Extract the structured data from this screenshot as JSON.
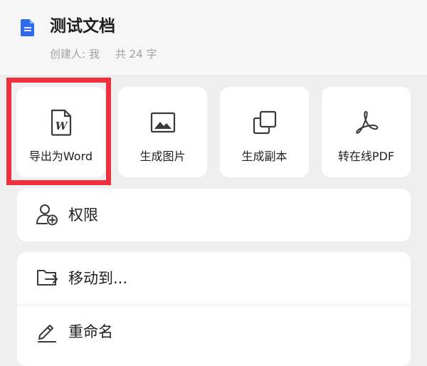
{
  "document": {
    "title": "测试文档",
    "creator": "创建人: 我",
    "word_count": "共 24 字"
  },
  "actions": [
    {
      "label": "导出为Word",
      "icon": "word-file-icon"
    },
    {
      "label": "生成图片",
      "icon": "image-icon"
    },
    {
      "label": "生成副本",
      "icon": "copy-icon"
    },
    {
      "label": "转在线PDF",
      "icon": "pdf-icon"
    }
  ],
  "menu": {
    "permissions": {
      "label": "权限",
      "icon": "user-add-icon"
    },
    "move_to": {
      "label": "移动到...",
      "icon": "folder-move-icon"
    },
    "rename": {
      "label": "重命名",
      "icon": "edit-icon"
    }
  },
  "colors": {
    "highlight": "#ef2f3e",
    "doc_icon": "#2f6bea"
  }
}
